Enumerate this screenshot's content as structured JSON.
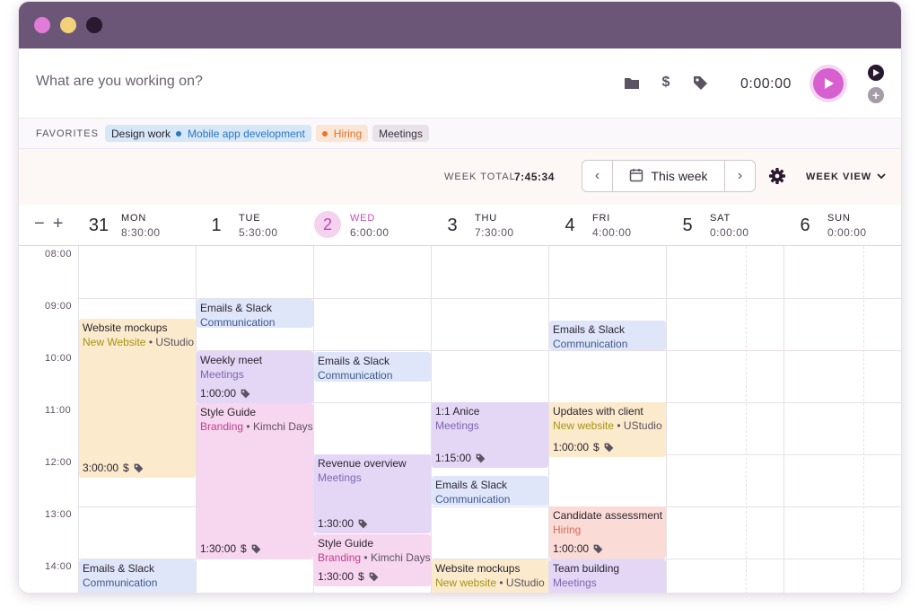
{
  "timer": {
    "placeholder": "What are you working on?",
    "value": "0:00:00",
    "icons": [
      "folder-icon",
      "dollar-icon",
      "tag-icon",
      "play-icon",
      "timer-mode-icon",
      "add-icon"
    ],
    "dollar_glyph": "$",
    "add_glyph": "+"
  },
  "favorites": {
    "label": "FAVORITES",
    "chips": [
      {
        "label": "Design work",
        "sub": "Mobile app development"
      },
      {
        "label": "Hiring"
      },
      {
        "label": "Meetings"
      }
    ]
  },
  "week": {
    "total_label": "WEEK TOTAL",
    "total_value": "7:45:34",
    "nav_label": "This week",
    "prev_glyph": "‹",
    "next_glyph": "›",
    "view_label": "WEEK VIEW"
  },
  "zoom": {
    "minus": "−",
    "plus": "+"
  },
  "days": [
    {
      "num": "31",
      "name": "MON",
      "total": "8:30:00"
    },
    {
      "num": "1",
      "name": "TUE",
      "total": "5:30:00"
    },
    {
      "num": "2",
      "name": "WED",
      "total": "6:00:00",
      "today": true
    },
    {
      "num": "3",
      "name": "THU",
      "total": "7:30:00"
    },
    {
      "num": "4",
      "name": "FRI",
      "total": "4:00:00"
    },
    {
      "num": "5",
      "name": "SAT",
      "total": "0:00:00"
    },
    {
      "num": "6",
      "name": "SUN",
      "total": "0:00:00"
    }
  ],
  "hours": [
    "08:00",
    "09:00",
    "10:00",
    "11:00",
    "12:00",
    "13:00",
    "14:00"
  ],
  "events": {
    "mon_website": {
      "title": "Website mockups",
      "project": "New Website",
      "client": "UStudio",
      "duration": "3:00:00"
    },
    "mon_emails": {
      "title": "Emails & Slack",
      "project": "Communication"
    },
    "tue_emails": {
      "title": "Emails & Slack",
      "project": "Communication"
    },
    "tue_weekly": {
      "title": "Weekly meet",
      "project": "Meetings",
      "duration": "1:00:00"
    },
    "tue_style": {
      "title": "Style Guide",
      "project": "Branding",
      "client": "Kimchi Days",
      "duration": "1:30:00"
    },
    "wed_emails": {
      "title": "Emails & Slack",
      "project": "Communication"
    },
    "wed_revenue": {
      "title": "Revenue overview",
      "project": "Meetings",
      "duration": "1:30:00"
    },
    "wed_style": {
      "title": "Style Guide",
      "project": "Branding",
      "client": "Kimchi Days",
      "duration": "1:30:00"
    },
    "thu_anice": {
      "title": "1:1 Anice",
      "project": "Meetings",
      "duration": "1:15:00"
    },
    "thu_emails": {
      "title": "Emails & Slack",
      "project": "Communication"
    },
    "thu_website": {
      "title": "Website mockups",
      "project": "New website",
      "client": "UStudio"
    },
    "fri_emails": {
      "title": "Emails & Slack",
      "project": "Communication"
    },
    "fri_updates": {
      "title": "Updates with client",
      "project": "New website",
      "client": "UStudio",
      "duration": "1:00:00"
    },
    "fri_candidate": {
      "title": "Candidate assessment",
      "project": "Hiring",
      "duration": "1:00:00"
    },
    "fri_team": {
      "title": "Team building",
      "project": "Meetings"
    }
  },
  "glyphs": {
    "dollar": "$",
    "bullet": "•"
  }
}
